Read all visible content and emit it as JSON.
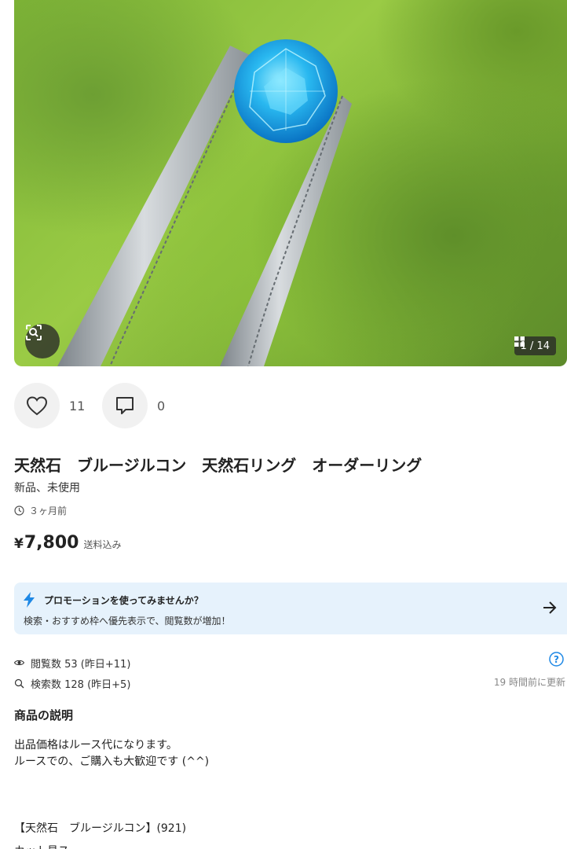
{
  "gallery": {
    "counter": "1 / 14",
    "icons": {
      "scan": "image-search-icon",
      "grid": "grid-icon"
    }
  },
  "actions": {
    "likes": "11",
    "comments": "0",
    "icons": {
      "like": "heart-icon",
      "comment": "comment-icon"
    }
  },
  "item": {
    "title": "天然石　ブルージルコン　天然石リング　オーダーリング",
    "condition": "新品、未使用",
    "posted": "３ヶ月前",
    "price_symbol": "¥",
    "price": "7,800",
    "shipping": "送料込み"
  },
  "promo": {
    "title": "プロモーションを使ってみませんか？",
    "subtitle": "検索・おすすめ枠へ優先表示で、閲覧数が増加！",
    "accent": "#1e88e5",
    "background": "#e6f2fc"
  },
  "stats": {
    "views": "閲覧数  53 (昨日+11)",
    "searches": "検索数  128 (昨日+5)",
    "updated": "19 時間前に更新"
  },
  "description": {
    "heading": "商品の説明",
    "lines": [
      "出品価格はルース代になります。",
      "ルースでの、ご購入も大歓迎です (^^)"
    ],
    "spec": "【天然石　ブルージルコン】(921)",
    "partial": "カット見ス"
  }
}
